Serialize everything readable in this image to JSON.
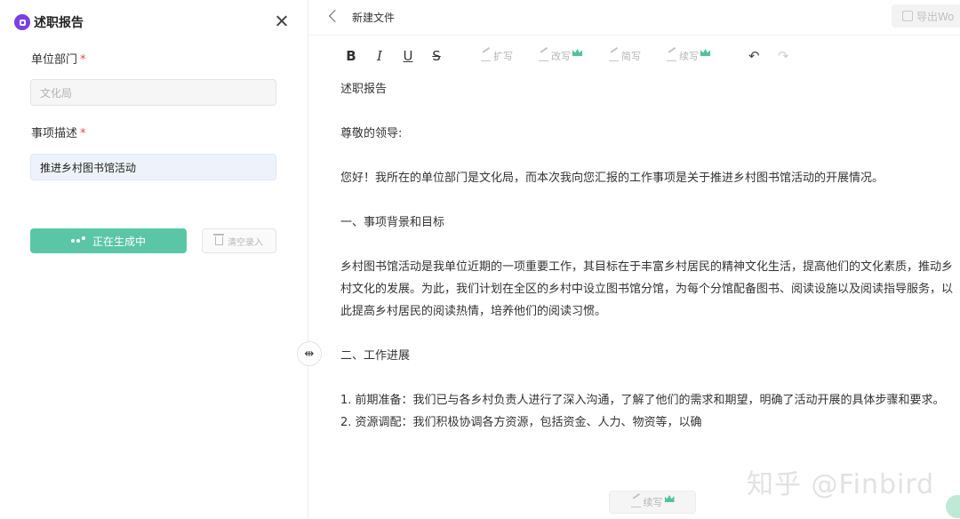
{
  "panel": {
    "title": "述职报告",
    "unit_label": "单位部门",
    "unit_required": "*",
    "unit_placeholder": "文化局",
    "desc_label": "事项描述",
    "desc_required": "*",
    "desc_value": "推进乡村图书馆活动",
    "generate_label": "正在生成中",
    "clear_label": "清空录入"
  },
  "editor": {
    "doc_name": "新建文件",
    "export_label": "导出Wo",
    "toolbar": {
      "bold": "B",
      "italic": "I",
      "underline": "U",
      "strike": "S",
      "expand": "扩写",
      "rewrite": "改写",
      "shorten": "简写",
      "continue": "续写",
      "undo": "↶",
      "redo": "↷"
    },
    "paragraphs": [
      "述职报告",
      "尊敬的领导:",
      "您好！我所在的单位部门是文化局，而本次我向您汇报的工作事项是关于推进乡村图书馆活动的开展情况。",
      "一、事项背景和目标",
      "乡村图书馆活动是我单位近期的一项重要工作，其目标在于丰富乡村居民的精神文化生活，提高他们的文化素质，推动乡村文化的发展。为此，我们计划在全区的乡村中设立图书馆分馆，为每个分馆配备图书、阅读设施以及阅读指导服务，以此提高乡村居民的阅读热情，培养他们的阅读习惯。",
      "二、工作进展",
      "1. 前期准备：我们已与各乡村负责人进行了深入沟通，了解了他们的需求和期望，明确了活动开展的具体步骤和要求。",
      "2. 资源调配：我们积极协调各方资源，包括资金、人力、物资等，以确"
    ],
    "float_continue": "续写"
  },
  "splitter_glyph": "⇹",
  "watermark": "知乎 @Finbird",
  "colors": {
    "accent": "#5bc6a6",
    "brand": "#7b3fe4",
    "premium": "#4cc59a",
    "required": "#e34a4a"
  }
}
